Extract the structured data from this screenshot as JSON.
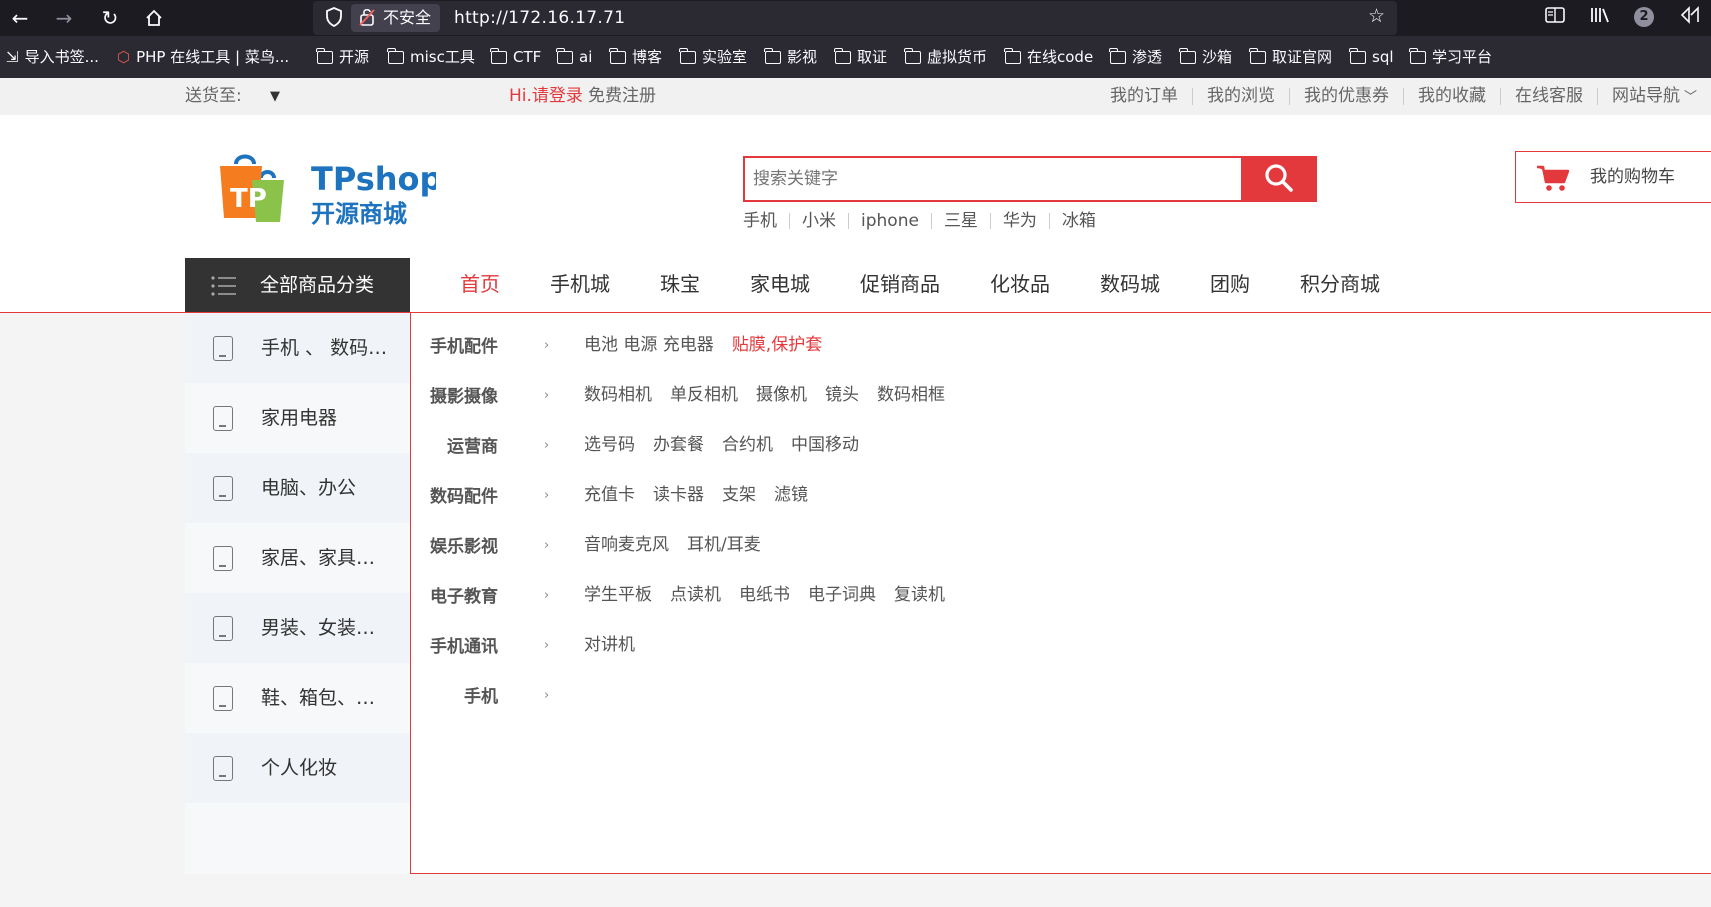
{
  "browser": {
    "security_label": "不安全",
    "url": "http://172.16.17.71",
    "extension_badge": "2",
    "bookmarks": [
      {
        "label": "导入书签...",
        "icon": "import-icon"
      },
      {
        "label": "PHP 在线工具 | 菜鸟...",
        "icon": "cube-icon"
      },
      {
        "label": "开源",
        "icon": "folder-icon"
      },
      {
        "label": "misc工具",
        "icon": "folder-icon"
      },
      {
        "label": "CTF",
        "icon": "folder-icon"
      },
      {
        "label": "ai",
        "icon": "folder-icon"
      },
      {
        "label": "博客",
        "icon": "folder-icon"
      },
      {
        "label": "实验室",
        "icon": "folder-icon"
      },
      {
        "label": "影视",
        "icon": "folder-icon"
      },
      {
        "label": "取证",
        "icon": "folder-icon"
      },
      {
        "label": "虚拟货币",
        "icon": "folder-icon"
      },
      {
        "label": "在线code",
        "icon": "folder-icon"
      },
      {
        "label": "渗透",
        "icon": "folder-icon"
      },
      {
        "label": "沙箱",
        "icon": "folder-icon"
      },
      {
        "label": "取证官网",
        "icon": "folder-icon"
      },
      {
        "label": "sql",
        "icon": "folder-icon"
      },
      {
        "label": "学习平台",
        "icon": "folder-icon"
      }
    ]
  },
  "topbar": {
    "ship_to": "送货至:",
    "login": "Hi.请登录",
    "register": "免费注册",
    "links": [
      "我的订单",
      "我的浏览",
      "我的优惠券",
      "我的收藏",
      "在线客服",
      "网站导航"
    ]
  },
  "header": {
    "logo_text": "TPshop",
    "logo_sub": "开源商城",
    "logo_badge": "TP",
    "search_placeholder": "搜索关键字",
    "hot_words": [
      "手机",
      "小米",
      "iphone",
      "三星",
      "华为",
      "冰箱"
    ],
    "cart_label": "我的购物车"
  },
  "nav": {
    "all_categories": "全部商品分类",
    "items": [
      "首页",
      "手机城",
      "珠宝",
      "家电城",
      "促销商品",
      "化妆品",
      "数码城",
      "团购",
      "积分商城"
    ]
  },
  "sidebar": {
    "items": [
      "手机 、 数码 、 通信",
      "家用电器",
      "电脑、办公",
      "家居、家具、家装、厨具",
      "男装、女装、童装、内衣",
      "鞋、箱包、钟表、奢侈品",
      "个人化妆"
    ]
  },
  "submenu": {
    "rows": [
      {
        "title": "手机配件",
        "links": [
          "电池 电源 充电器",
          "贴膜,保护套"
        ]
      },
      {
        "title": "摄影摄像",
        "links": [
          "数码相机",
          "单反相机",
          "摄像机",
          "镜头",
          "数码相框"
        ]
      },
      {
        "title": "运营商",
        "links": [
          "选号码",
          "办套餐",
          "合约机",
          "中国移动"
        ]
      },
      {
        "title": "数码配件",
        "links": [
          "充值卡",
          "读卡器",
          "支架",
          "滤镜"
        ]
      },
      {
        "title": "娱乐影视",
        "links": [
          "音响麦克风",
          "耳机/耳麦"
        ]
      },
      {
        "title": "电子教育",
        "links": [
          "学生平板",
          "点读机",
          "电纸书",
          "电子词典",
          "复读机"
        ]
      },
      {
        "title": "手机通讯",
        "links": [
          "对讲机"
        ]
      },
      {
        "title": "手机",
        "links": []
      }
    ]
  },
  "colors": {
    "accent": "#e4393c",
    "browser_dark": "#1c1b22",
    "category_bar": "#333333"
  }
}
